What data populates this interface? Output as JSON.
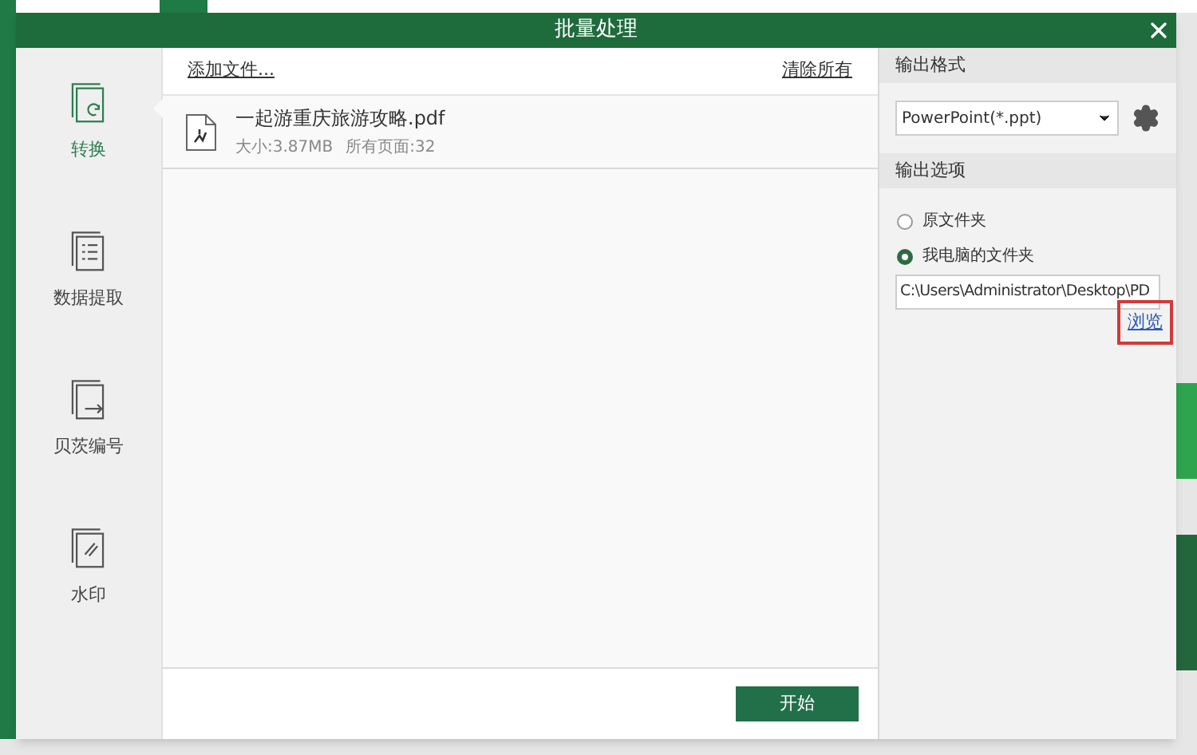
{
  "dialog": {
    "title": "批量处理"
  },
  "sidebar": {
    "items": [
      {
        "label": "转换",
        "kind": "convert",
        "selected": true
      },
      {
        "label": "数据提取",
        "kind": "extract",
        "selected": false
      },
      {
        "label": "贝茨编号",
        "kind": "bates",
        "selected": false
      },
      {
        "label": "水印",
        "kind": "watermark",
        "selected": false
      }
    ]
  },
  "file_list": {
    "add_files": "添加文件...",
    "clear_all": "清除所有",
    "files": [
      {
        "name": "一起游重庆旅游攻略.pdf",
        "size": "大小:3.87MB",
        "pages": "所有页面:32"
      }
    ]
  },
  "start_button": "开始",
  "output_format": {
    "heading": "输出格式",
    "value": "PowerPoint(*.ppt)"
  },
  "output_options": {
    "heading": "输出选项",
    "radios": [
      {
        "label": "原文件夹",
        "selected": false
      },
      {
        "label": "我电脑的文件夹",
        "selected": true
      }
    ],
    "path": "C:\\Users\\Administrator\\Desktop\\PD",
    "browse": "浏览",
    "browse_highlighted": true
  }
}
